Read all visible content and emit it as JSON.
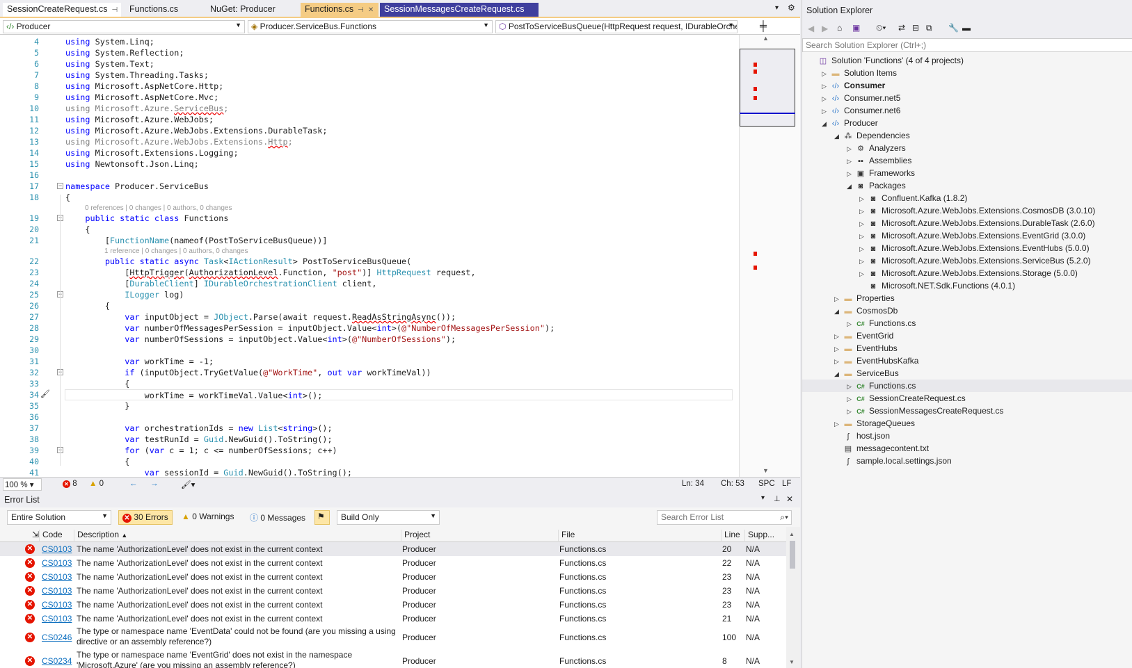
{
  "tabs": [
    {
      "label": "SessionCreateRequest.cs",
      "pin": "⊣",
      "close": "✕"
    },
    {
      "label": "Functions.cs"
    },
    {
      "label": "NuGet: Producer"
    },
    {
      "label": "Functions.cs",
      "pin": "⊣",
      "close": "✕"
    },
    {
      "label": "SessionMessagesCreateRequest.cs"
    }
  ],
  "nav": {
    "project": "Producer",
    "type": "Producer.ServiceBus.Functions",
    "member": "PostToServiceBusQueue(HttpRequest request, IDurableOrche"
  },
  "lines": [
    {
      "n": "4",
      "t": "using System.Linq;"
    },
    {
      "n": "5",
      "t": "using System.Reflection;"
    },
    {
      "n": "6",
      "t": "using System.Text;"
    },
    {
      "n": "7",
      "t": "using System.Threading.Tasks;"
    },
    {
      "n": "8",
      "t": "using Microsoft.AspNetCore.Http;"
    },
    {
      "n": "9",
      "t": "using Microsoft.AspNetCore.Mvc;"
    },
    {
      "n": "10",
      "t": "using Microsoft.Azure.ServiceBus;"
    },
    {
      "n": "11",
      "t": "using Microsoft.Azure.WebJobs;"
    },
    {
      "n": "12",
      "t": "using Microsoft.Azure.WebJobs.Extensions.DurableTask;"
    },
    {
      "n": "13",
      "t": "using Microsoft.Azure.WebJobs.Extensions.Http;"
    },
    {
      "n": "14",
      "t": "using Microsoft.Extensions.Logging;"
    },
    {
      "n": "15",
      "t": "using Newtonsoft.Json.Linq;"
    },
    {
      "n": "16",
      "t": ""
    },
    {
      "n": "17",
      "t": "namespace Producer.ServiceBus"
    },
    {
      "n": "18",
      "t": "{"
    },
    {
      "n": "19",
      "t": "    public static class Functions"
    },
    {
      "n": "20",
      "t": "    {"
    },
    {
      "n": "21",
      "t": "        [FunctionName(nameof(PostToServiceBusQueue))]"
    },
    {
      "n": "22",
      "t": "        public static async Task<IActionResult> PostToServiceBusQueue("
    },
    {
      "n": "23",
      "t": "            [HttpTrigger(AuthorizationLevel.Function, \"post\")] HttpRequest request,"
    },
    {
      "n": "24",
      "t": "            [DurableClient] IDurableOrchestrationClient client,"
    },
    {
      "n": "25",
      "t": "            ILogger log)"
    },
    {
      "n": "26",
      "t": "        {"
    },
    {
      "n": "27",
      "t": "            var inputObject = JObject.Parse(await request.ReadAsStringAsync());"
    },
    {
      "n": "28",
      "t": "            var numberOfMessagesPerSession = inputObject.Value<int>(@\"NumberOfMessagesPerSession\");"
    },
    {
      "n": "29",
      "t": "            var numberOfSessions = inputObject.Value<int>(@\"NumberOfSessions\");"
    },
    {
      "n": "30",
      "t": ""
    },
    {
      "n": "31",
      "t": "            var workTime = -1;"
    },
    {
      "n": "32",
      "t": "            if (inputObject.TryGetValue(@\"WorkTime\", out var workTimeVal))"
    },
    {
      "n": "33",
      "t": "            {"
    },
    {
      "n": "34",
      "t": "                workTime = workTimeVal.Value<int>();"
    },
    {
      "n": "35",
      "t": "            }"
    },
    {
      "n": "36",
      "t": ""
    },
    {
      "n": "37",
      "t": "            var orchestrationIds = new List<string>();"
    },
    {
      "n": "38",
      "t": "            var testRunId = Guid.NewGuid().ToString();"
    },
    {
      "n": "39",
      "t": "            for (var c = 1; c <= numberOfSessions; c++)"
    },
    {
      "n": "40",
      "t": "            {"
    },
    {
      "n": "41",
      "t": "                var sessionId = Guid.NewGuid().ToString();"
    }
  ],
  "lens": {
    "class": "0 references | 0 changes | 0 authors, 0 changes",
    "method": "1 reference | 0 changes | 0 authors, 0 changes"
  },
  "status": {
    "zoom": "100 %",
    "errors": "8",
    "warnings": "0",
    "ln": "Ln: 34",
    "ch": "Ch: 53",
    "spc": "SPC",
    "lf": "LF"
  },
  "errorlist": {
    "title": "Error List",
    "scope": "Entire Solution",
    "errors_btn": "30 Errors",
    "warnings_btn": "0 Warnings",
    "messages_btn": "0 Messages",
    "build": "Build Only",
    "search": "Search Error List",
    "cols": {
      "code": "Code",
      "desc": "Description",
      "project": "Project",
      "file": "File",
      "line": "Line",
      "supp": "Supp..."
    },
    "rows": [
      {
        "code": "CS0103",
        "desc": "The name 'AuthorizationLevel' does not exist in the current context",
        "project": "Producer",
        "file": "Functions.cs",
        "line": "20",
        "supp": "N/A"
      },
      {
        "code": "CS0103",
        "desc": "The name 'AuthorizationLevel' does not exist in the current context",
        "project": "Producer",
        "file": "Functions.cs",
        "line": "22",
        "supp": "N/A"
      },
      {
        "code": "CS0103",
        "desc": "The name 'AuthorizationLevel' does not exist in the current context",
        "project": "Producer",
        "file": "Functions.cs",
        "line": "23",
        "supp": "N/A"
      },
      {
        "code": "CS0103",
        "desc": "The name 'AuthorizationLevel' does not exist in the current context",
        "project": "Producer",
        "file": "Functions.cs",
        "line": "23",
        "supp": "N/A"
      },
      {
        "code": "CS0103",
        "desc": "The name 'AuthorizationLevel' does not exist in the current context",
        "project": "Producer",
        "file": "Functions.cs",
        "line": "23",
        "supp": "N/A"
      },
      {
        "code": "CS0103",
        "desc": "The name 'AuthorizationLevel' does not exist in the current context",
        "project": "Producer",
        "file": "Functions.cs",
        "line": "21",
        "supp": "N/A"
      },
      {
        "code": "CS0246",
        "desc": "The type or namespace name 'EventData' could not be found (are you missing a using",
        "desc2": "directive or an assembly reference?)",
        "project": "Producer",
        "file": "Functions.cs",
        "line": "100",
        "supp": "N/A"
      },
      {
        "code": "CS0234",
        "desc": "The type or namespace name 'EventGrid' does not exist in the namespace",
        "desc2": "'Microsoft.Azure' (are you missing an assembly reference?)",
        "project": "Producer",
        "file": "Functions.cs",
        "line": "8",
        "supp": "N/A"
      }
    ]
  },
  "solution": {
    "title": "Solution Explorer",
    "search": "Search Solution Explorer (Ctrl+;)",
    "items": [
      {
        "label": "Solution 'Functions' (4 of 4 projects)",
        "d": 0,
        "ic": "sln",
        "tg": ""
      },
      {
        "label": "Solution Items",
        "d": 1,
        "ic": "folder",
        "tg": "▷"
      },
      {
        "label": "Consumer",
        "d": 1,
        "ic": "proj",
        "tg": "▷",
        "bold": true
      },
      {
        "label": "Consumer.net5",
        "d": 1,
        "ic": "proj",
        "tg": "▷"
      },
      {
        "label": "Consumer.net6",
        "d": 1,
        "ic": "proj",
        "tg": "▷"
      },
      {
        "label": "Producer",
        "d": 1,
        "ic": "proj",
        "tg": "◢"
      },
      {
        "label": "Dependencies",
        "d": 2,
        "ic": "dep",
        "tg": "◢"
      },
      {
        "label": "Analyzers",
        "d": 3,
        "ic": "ana",
        "tg": "▷"
      },
      {
        "label": "Assemblies",
        "d": 3,
        "ic": "asm",
        "tg": "▷"
      },
      {
        "label": "Frameworks",
        "d": 3,
        "ic": "fw",
        "tg": "▷"
      },
      {
        "label": "Packages",
        "d": 3,
        "ic": "pkg",
        "tg": "◢"
      },
      {
        "label": "Confluent.Kafka (1.8.2)",
        "d": 4,
        "ic": "pkg",
        "tg": "▷"
      },
      {
        "label": "Microsoft.Azure.WebJobs.Extensions.CosmosDB (3.0.10)",
        "d": 4,
        "ic": "pkg",
        "tg": "▷"
      },
      {
        "label": "Microsoft.Azure.WebJobs.Extensions.DurableTask (2.6.0)",
        "d": 4,
        "ic": "pkg",
        "tg": "▷"
      },
      {
        "label": "Microsoft.Azure.WebJobs.Extensions.EventGrid (3.0.0)",
        "d": 4,
        "ic": "pkg",
        "tg": "▷"
      },
      {
        "label": "Microsoft.Azure.WebJobs.Extensions.EventHubs (5.0.0)",
        "d": 4,
        "ic": "pkg",
        "tg": "▷"
      },
      {
        "label": "Microsoft.Azure.WebJobs.Extensions.ServiceBus (5.2.0)",
        "d": 4,
        "ic": "pkg",
        "tg": "▷"
      },
      {
        "label": "Microsoft.Azure.WebJobs.Extensions.Storage (5.0.0)",
        "d": 4,
        "ic": "pkg",
        "tg": "▷"
      },
      {
        "label": "Microsoft.NET.Sdk.Functions (4.0.1)",
        "d": 4,
        "ic": "pkg",
        "tg": ""
      },
      {
        "label": "Properties",
        "d": 2,
        "ic": "folder",
        "tg": "▷"
      },
      {
        "label": "CosmosDb",
        "d": 2,
        "ic": "folder",
        "tg": "◢"
      },
      {
        "label": "Functions.cs",
        "d": 3,
        "ic": "cs",
        "tg": "▷"
      },
      {
        "label": "EventGrid",
        "d": 2,
        "ic": "folder",
        "tg": "▷"
      },
      {
        "label": "EventHubs",
        "d": 2,
        "ic": "folder",
        "tg": "▷"
      },
      {
        "label": "EventHubsKafka",
        "d": 2,
        "ic": "folder",
        "tg": "▷"
      },
      {
        "label": "ServiceBus",
        "d": 2,
        "ic": "folder",
        "tg": "◢"
      },
      {
        "label": "Functions.cs",
        "d": 3,
        "ic": "cs",
        "tg": "▷",
        "sel": true
      },
      {
        "label": "SessionCreateRequest.cs",
        "d": 3,
        "ic": "cs",
        "tg": "▷"
      },
      {
        "label": "SessionMessagesCreateRequest.cs",
        "d": 3,
        "ic": "cs",
        "tg": "▷"
      },
      {
        "label": "StorageQueues",
        "d": 2,
        "ic": "folder",
        "tg": "▷"
      },
      {
        "label": "host.json",
        "d": 2,
        "ic": "json",
        "tg": ""
      },
      {
        "label": "messagecontent.txt",
        "d": 2,
        "ic": "txt",
        "tg": ""
      },
      {
        "label": "sample.local.settings.json",
        "d": 2,
        "ic": "json",
        "tg": ""
      }
    ]
  }
}
